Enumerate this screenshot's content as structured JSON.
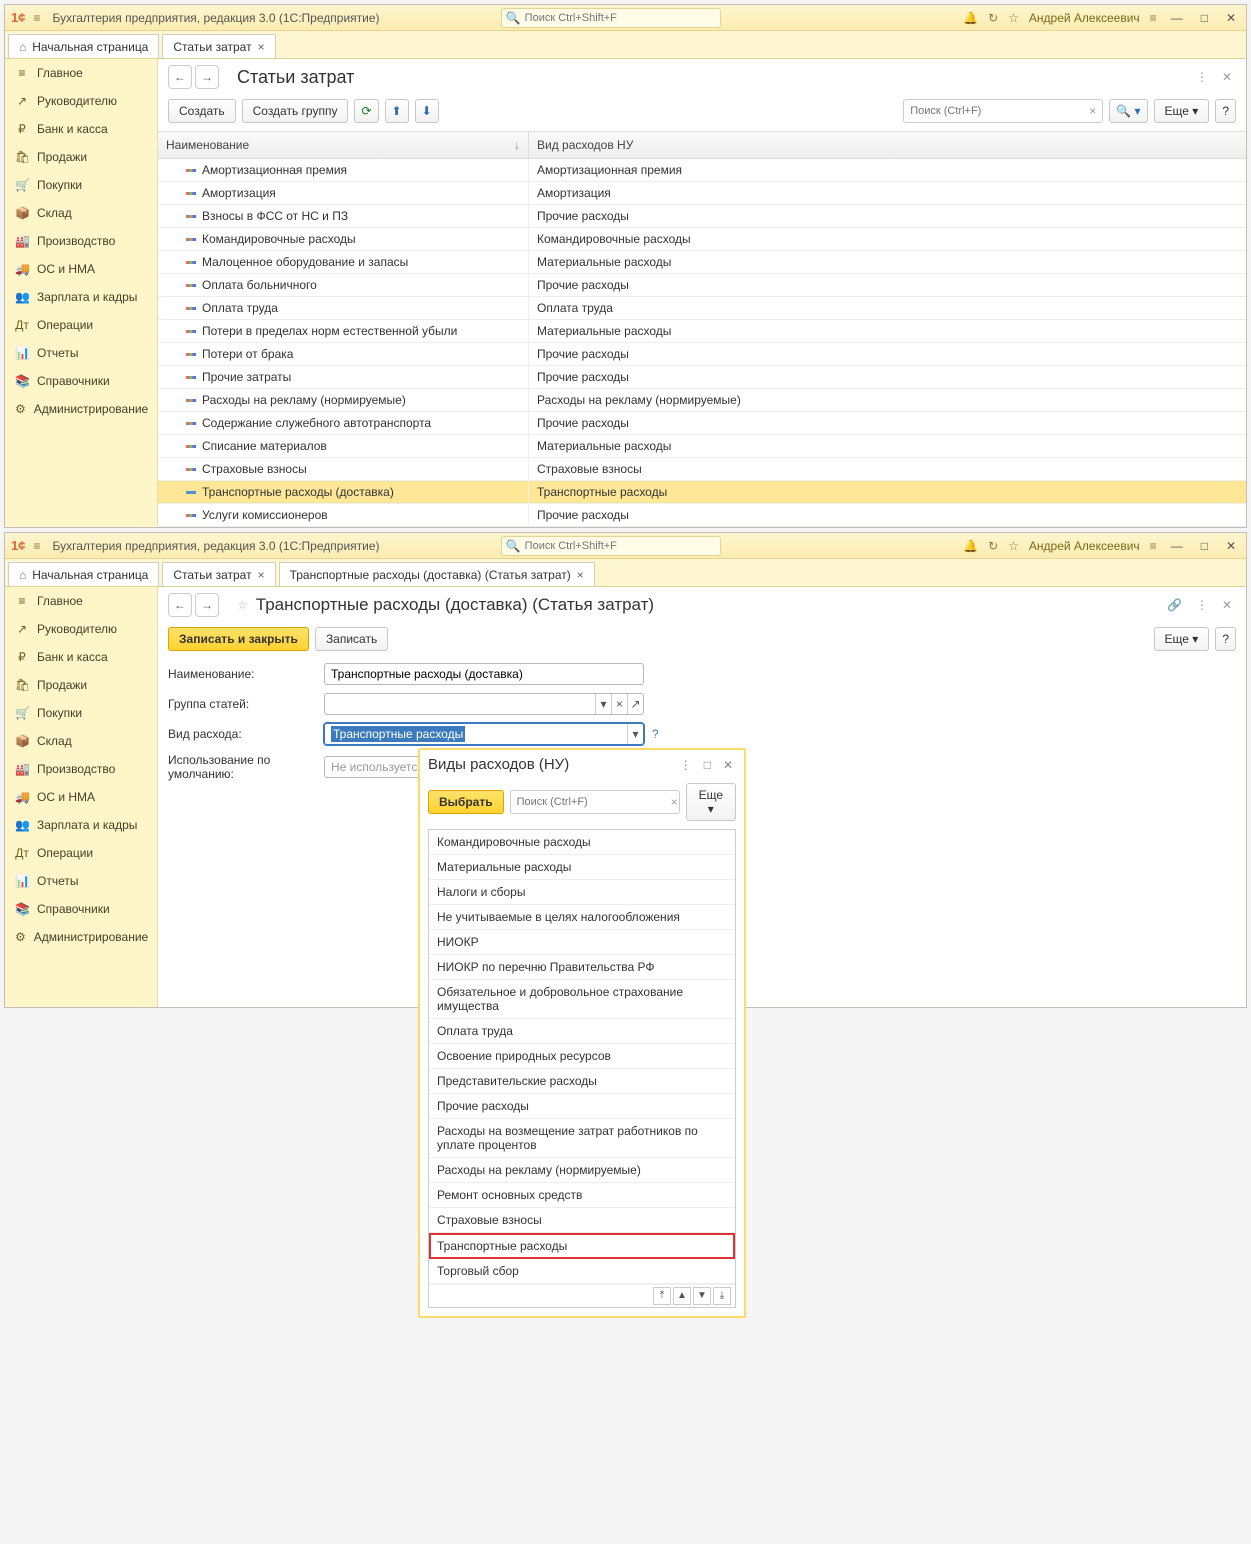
{
  "app": {
    "title": "Бухгалтерия предприятия, редакция 3.0  (1С:Предприятие)",
    "search_placeholder": "Поиск Ctrl+Shift+F",
    "user": "Андрей Алексеевич"
  },
  "sidebar": {
    "items": [
      {
        "icon": "≡",
        "label": "Главное"
      },
      {
        "icon": "↗",
        "label": "Руководителю"
      },
      {
        "icon": "₽",
        "label": "Банк и касса"
      },
      {
        "icon": "🛍",
        "label": "Продажи"
      },
      {
        "icon": "🛒",
        "label": "Покупки"
      },
      {
        "icon": "📦",
        "label": "Склад"
      },
      {
        "icon": "🏭",
        "label": "Производство"
      },
      {
        "icon": "🚚",
        "label": "ОС и НМА"
      },
      {
        "icon": "👥",
        "label": "Зарплата и кадры"
      },
      {
        "icon": "Дт",
        "label": "Операции"
      },
      {
        "icon": "📊",
        "label": "Отчеты"
      },
      {
        "icon": "📚",
        "label": "Справочники"
      },
      {
        "icon": "⚙",
        "label": "Администрирование"
      }
    ]
  },
  "window1": {
    "tabs": [
      {
        "label": "Начальная страница",
        "home": true
      },
      {
        "label": "Статьи затрат",
        "close": true,
        "active": true
      }
    ],
    "page_title": "Статьи затрат",
    "toolbar": {
      "create": "Создать",
      "create_group": "Создать группу",
      "find_placeholder": "Поиск (Ctrl+F)",
      "more": "Еще"
    },
    "columns": {
      "c1": "Наименование",
      "c2": "Вид расходов НУ"
    },
    "rows": [
      {
        "name": "Амортизационная премия",
        "kind": "Амортизационная премия"
      },
      {
        "name": "Амортизация",
        "kind": "Амортизация"
      },
      {
        "name": "Взносы в ФСС от НС и ПЗ",
        "kind": "Прочие расходы"
      },
      {
        "name": "Командировочные расходы",
        "kind": "Командировочные расходы"
      },
      {
        "name": "Малоценное оборудование и запасы",
        "kind": "Материальные расходы"
      },
      {
        "name": "Оплата больничного",
        "kind": "Прочие расходы"
      },
      {
        "name": "Оплата труда",
        "kind": "Оплата труда"
      },
      {
        "name": "Потери в пределах норм естественной убыли",
        "kind": "Материальные расходы"
      },
      {
        "name": "Потери от брака",
        "kind": "Прочие расходы"
      },
      {
        "name": "Прочие затраты",
        "kind": "Прочие расходы"
      },
      {
        "name": "Расходы на рекламу (нормируемые)",
        "kind": "Расходы на рекламу (нормируемые)"
      },
      {
        "name": "Содержание служебного автотранспорта",
        "kind": "Прочие расходы"
      },
      {
        "name": "Списание материалов",
        "kind": "Материальные расходы"
      },
      {
        "name": "Страховые взносы",
        "kind": "Страховые взносы"
      },
      {
        "name": "Транспортные расходы (доставка)",
        "kind": "Транспортные расходы",
        "active": true
      },
      {
        "name": "Услуги комиссионеров",
        "kind": "Прочие расходы"
      }
    ]
  },
  "window2": {
    "tabs": [
      {
        "label": "Начальная страница",
        "home": true
      },
      {
        "label": "Статьи затрат",
        "close": true
      },
      {
        "label": "Транспортные расходы (доставка) (Статья затрат)",
        "close": true,
        "active": true
      }
    ],
    "page_title": "Транспортные расходы (доставка) (Статья затрат)",
    "toolbar": {
      "save_close": "Записать и закрыть",
      "save": "Записать",
      "more": "Еще"
    },
    "form": {
      "name_label": "Наименование:",
      "name_value": "Транспортные расходы (доставка)",
      "group_label": "Группа статей:",
      "group_value": "",
      "kind_label": "Вид расхода:",
      "kind_value": "Транспортные расходы",
      "default_label": "Использование по умолчанию:",
      "default_placeholder": "Не используется"
    }
  },
  "popup": {
    "title": "Виды расходов (НУ)",
    "select": "Выбрать",
    "search_placeholder": "Поиск (Ctrl+F)",
    "more": "Еще",
    "items": [
      "Командировочные расходы",
      "Материальные расходы",
      "Налоги и сборы",
      "Не учитываемые в целях налогообложения",
      "НИОКР",
      "НИОКР по перечню Правительства РФ",
      "Обязательное и добровольное страхование имущества",
      "Оплата труда",
      "Освоение природных ресурсов",
      "Представительские расходы",
      "Прочие расходы",
      "Расходы на возмещение затрат работников по уплате процентов",
      "Расходы на рекламу (нормируемые)",
      "Ремонт основных средств",
      "Страховые взносы",
      "Транспортные расходы",
      "Торговый сбор"
    ],
    "highlight_index": 15
  }
}
